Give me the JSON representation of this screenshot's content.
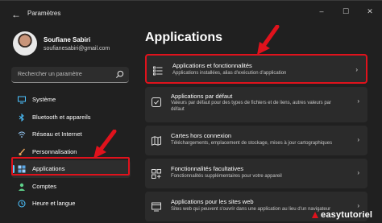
{
  "window": {
    "title": "Paramètres",
    "back_icon": "back-arrow-icon",
    "controls": [
      "minimize-icon",
      "maximize-icon",
      "close-icon"
    ]
  },
  "user": {
    "name": "Soufiane Sabiri",
    "email": "soufianesabiri@gmail.com"
  },
  "search": {
    "placeholder": "Rechercher un paramètre"
  },
  "sidebar": {
    "items": [
      {
        "label": "Système",
        "icon": "system-icon"
      },
      {
        "label": "Bluetooth et appareils",
        "icon": "bluetooth-icon"
      },
      {
        "label": "Réseau et Internet",
        "icon": "network-icon"
      },
      {
        "label": "Personnalisation",
        "icon": "brush-icon"
      },
      {
        "label": "Applications",
        "icon": "apps-icon",
        "selected": true
      },
      {
        "label": "Comptes",
        "icon": "account-icon"
      },
      {
        "label": "Heure et langue",
        "icon": "time-language-icon"
      }
    ]
  },
  "main": {
    "title": "Applications",
    "cards": [
      {
        "title": "Applications et fonctionnalités",
        "subtitle": "Applications installées, alias d'exécution d'application",
        "icon": "apps-list-icon"
      },
      {
        "title": "Applications par défaut",
        "subtitle": "Valeurs par défaut pour des types de fichiers et de liens, autres valeurs par défaut",
        "icon": "default-apps-icon"
      },
      {
        "title": "Cartes hors connexion",
        "subtitle": "Téléchargements, emplacement de stockage, mises à jour cartographiques",
        "icon": "map-icon"
      },
      {
        "title": "Fonctionnalités facultatives",
        "subtitle": "Fonctionnalités supplémentaires pour votre appareil",
        "icon": "optional-features-icon"
      },
      {
        "title": "Applications pour les sites web",
        "subtitle": "Sites web qui peuvent s'ouvrir dans une application au lieu d'un navigateur",
        "icon": "web-apps-icon"
      }
    ]
  },
  "watermark": {
    "text": "easytutoriel"
  },
  "colors": {
    "background": "#202020",
    "card": "#2b2b2b",
    "accent": "#60cdff",
    "annotation_red": "#e0121c"
  }
}
